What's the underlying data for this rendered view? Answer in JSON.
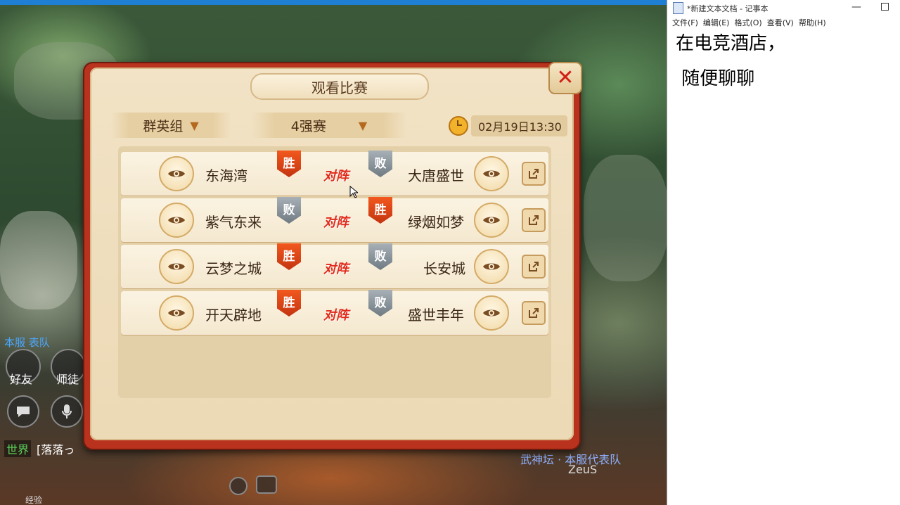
{
  "game": {
    "dialog": {
      "title": "观看比赛",
      "group_dropdown": "群英组",
      "round_dropdown": "4强赛",
      "time": "02月19日13:30",
      "vs_label": "对阵",
      "win_label": "胜",
      "lose_label": "败",
      "matches": [
        {
          "left": "东海湾",
          "right": "大唐盛世",
          "left_result": "胜",
          "right_result": "败"
        },
        {
          "left": "紫气东来",
          "right": "绿烟如梦",
          "left_result": "败",
          "right_result": "胜"
        },
        {
          "left": "云梦之城",
          "right": "长安城",
          "left_result": "胜",
          "right_result": "败"
        },
        {
          "left": "开天辟地",
          "right": "盛世丰年",
          "left_result": "胜",
          "right_result": "败"
        }
      ]
    },
    "hud": {
      "friends_label": "好友",
      "master_label": "师徒",
      "team_label": "本服  表队",
      "world_channel": "世界",
      "world_msg": "[落落っ",
      "right_banner": "武神坛 · 本服代表队",
      "right_name": "ZeuS",
      "exp_label": "经验"
    }
  },
  "notepad": {
    "title": "*新建文本文档 - 记事本",
    "menu": [
      "文件(F)",
      "编辑(E)",
      "格式(O)",
      "查看(V)",
      "帮助(H)"
    ],
    "lines": [
      "在电竞酒店，",
      " 随便聊聊"
    ]
  }
}
